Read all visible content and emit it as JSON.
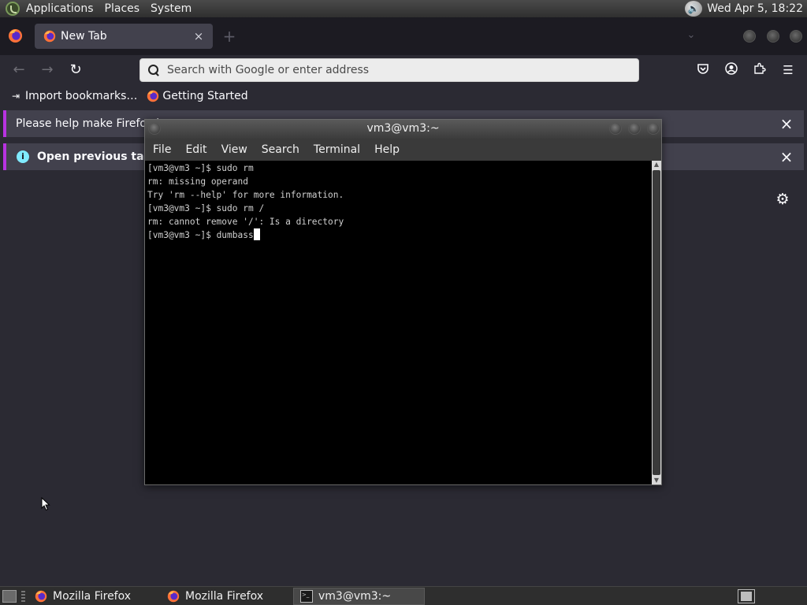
{
  "top_panel": {
    "menus": [
      "Applications",
      "Places",
      "System"
    ],
    "clock": "Wed Apr  5, 18:22"
  },
  "browser": {
    "tab": {
      "title": "New Tab",
      "close_glyph": "×"
    },
    "new_tab_glyph": "+",
    "nav": {
      "back": "←",
      "forward": "→",
      "reload": "↻"
    },
    "url_bar": {
      "placeholder": "Search with Google or enter address",
      "value": ""
    },
    "toolbar_icons": [
      "pocket-icon",
      "account-icon",
      "extensions-icon",
      "menu-icon"
    ],
    "bookmarks": [
      {
        "label": "Import bookmarks…",
        "icon": "import-icon"
      },
      {
        "label": "Getting Started",
        "icon": "firefox-icon"
      }
    ],
    "notifications": [
      {
        "text": "Please help make Firefox be",
        "bold": false
      },
      {
        "text": "Open previous tabs?",
        "bold": true
      }
    ],
    "accent_color": "#b833e1"
  },
  "terminal": {
    "title": "vm3@vm3:~",
    "menu": [
      "File",
      "Edit",
      "View",
      "Search",
      "Terminal",
      "Help"
    ],
    "lines": [
      "[vm3@vm3 ~]$ sudo rm",
      "rm: missing operand",
      "Try 'rm --help' for more information.",
      "[vm3@vm3 ~]$ sudo rm /",
      "rm: cannot remove '/': Is a directory"
    ],
    "prompt": "[vm3@vm3 ~]$ ",
    "current_input": "dumbass"
  },
  "taskbar": {
    "tasks": [
      {
        "label": "Mozilla Firefox",
        "icon": "firefox-icon",
        "active": false
      },
      {
        "label": "Mozilla Firefox",
        "icon": "firefox-icon",
        "active": false
      },
      {
        "label": "vm3@vm3:~",
        "icon": "terminal-icon",
        "active": true
      }
    ]
  }
}
